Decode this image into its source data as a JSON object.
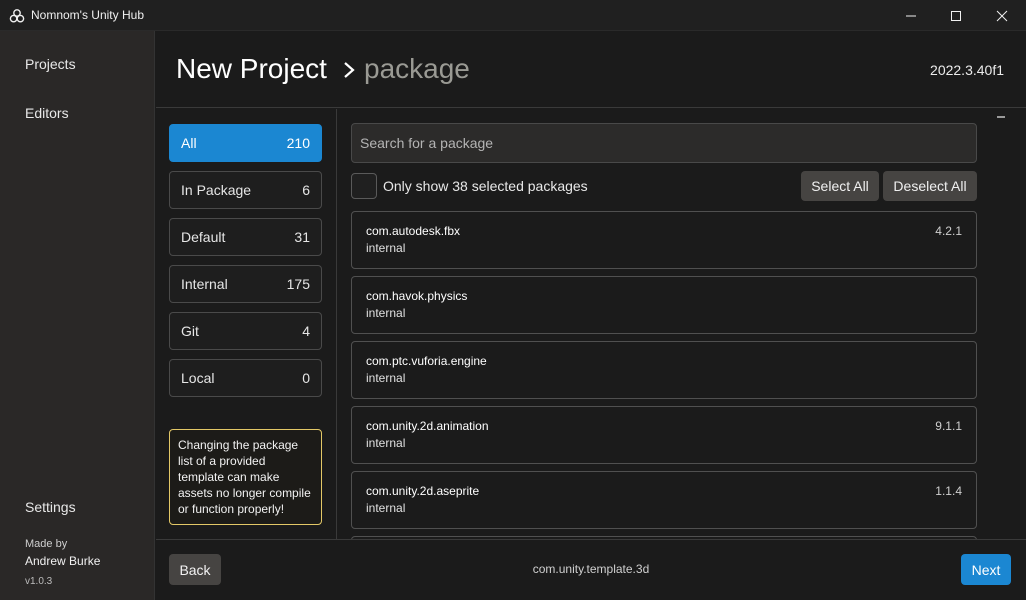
{
  "window": {
    "title": "Nomnom's Unity Hub",
    "icon": "unity-cube-icon"
  },
  "sidebar": {
    "items": [
      {
        "label": "Projects"
      },
      {
        "label": "Editors"
      },
      {
        "label": "Settings"
      }
    ],
    "made_by_label": "Made by",
    "author": "Andrew Burke",
    "version": "v1.0.3"
  },
  "header": {
    "title": "New Project",
    "subtitle": "package",
    "editor_version": "2022.3.40f1"
  },
  "filters": [
    {
      "label": "All",
      "count": "210",
      "active": true
    },
    {
      "label": "In Package",
      "count": "6",
      "active": false
    },
    {
      "label": "Default",
      "count": "31",
      "active": false
    },
    {
      "label": "Internal",
      "count": "175",
      "active": false
    },
    {
      "label": "Git",
      "count": "4",
      "active": false
    },
    {
      "label": "Local",
      "count": "0",
      "active": false
    }
  ],
  "warning": "Changing the package list of a provided template can make assets no longer compile or function properly!",
  "search": {
    "placeholder": "Search for a package",
    "value": ""
  },
  "only_selected_label": "Only show 38 selected packages",
  "buttons": {
    "select_all": "Select All",
    "deselect_all": "Deselect All",
    "back": "Back",
    "next": "Next"
  },
  "packages": [
    {
      "name": "com.autodesk.fbx",
      "source": "internal",
      "version": "4.2.1"
    },
    {
      "name": "com.havok.physics",
      "source": "internal",
      "version": ""
    },
    {
      "name": "com.ptc.vuforia.engine",
      "source": "internal",
      "version": ""
    },
    {
      "name": "com.unity.2d.animation",
      "source": "internal",
      "version": "9.1.1"
    },
    {
      "name": "com.unity.2d.aseprite",
      "source": "internal",
      "version": "1.1.4"
    }
  ],
  "footer": {
    "template": "com.unity.template.3d"
  },
  "colors": {
    "accent": "#1b87d2",
    "warning_border": "#e3c867",
    "background": "#1b1b1b",
    "sidebar": "#2a2827"
  }
}
